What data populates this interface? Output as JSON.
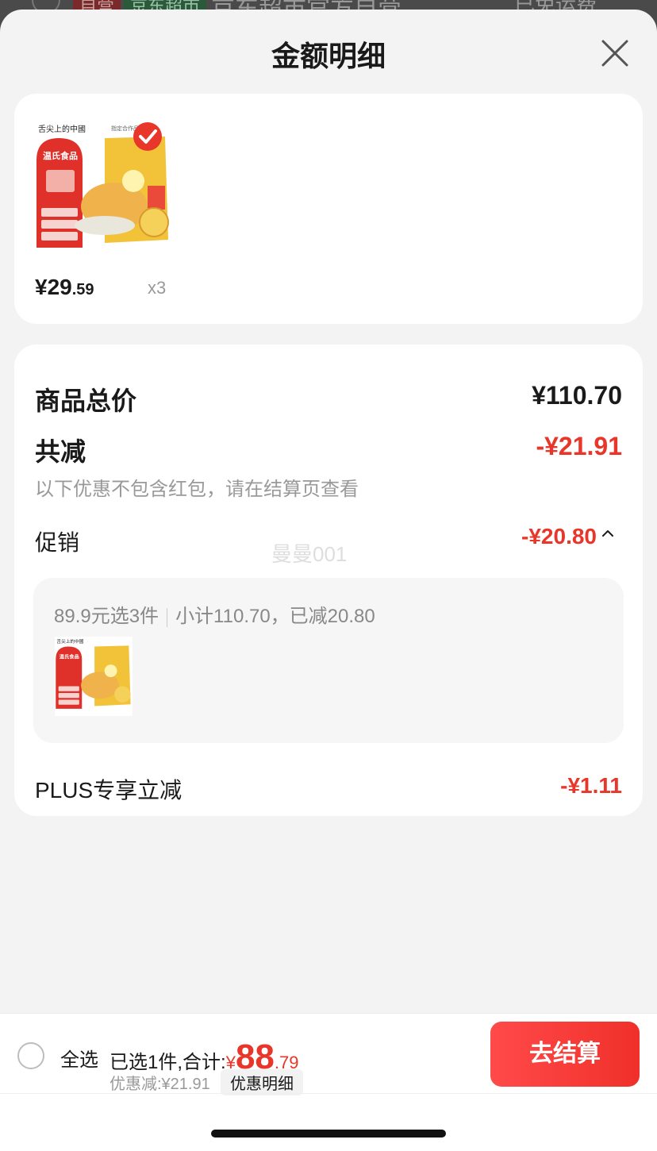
{
  "background": {
    "tag_self_run": "自营",
    "tag_supermarket": "京东超市",
    "store_name": "京东超市官方自营",
    "right_text": "已免运费"
  },
  "sheet": {
    "title": "金额明细",
    "close_icon": "close-icon"
  },
  "product": {
    "image_icon": "product-thumbnail",
    "price_symbol_int": "¥29",
    "price_dec": ".59",
    "quantity": "x3"
  },
  "detail": {
    "total_label": "商品总价",
    "total_value": "¥110.70",
    "reduce_label": "共减",
    "reduce_value": "-¥21.91",
    "note": "以下优惠不包含红包，请在结算页查看",
    "promo_label": "促销",
    "promo_value": "-¥20.80",
    "promo_caret": "^",
    "watermark": "曼曼001",
    "promo_rule": "89.9元选3件",
    "promo_subtotal": "小计110.70，已减20.80",
    "plus_label": "PLUS专享立减",
    "plus_value": "-¥1.11"
  },
  "bottom": {
    "select_all": "全选",
    "selected_text": "已选1件,合计:",
    "currency": "¥",
    "amount_int": "88",
    "amount_dec": ".79",
    "discount_text": "优惠减:¥21.91",
    "detail_button": "优惠明细",
    "checkout_button": "去结算"
  },
  "colors": {
    "accent_red": "#e8362b",
    "checkout_gradient_start": "#ff4a4a",
    "checkout_gradient_end": "#f0302a"
  }
}
